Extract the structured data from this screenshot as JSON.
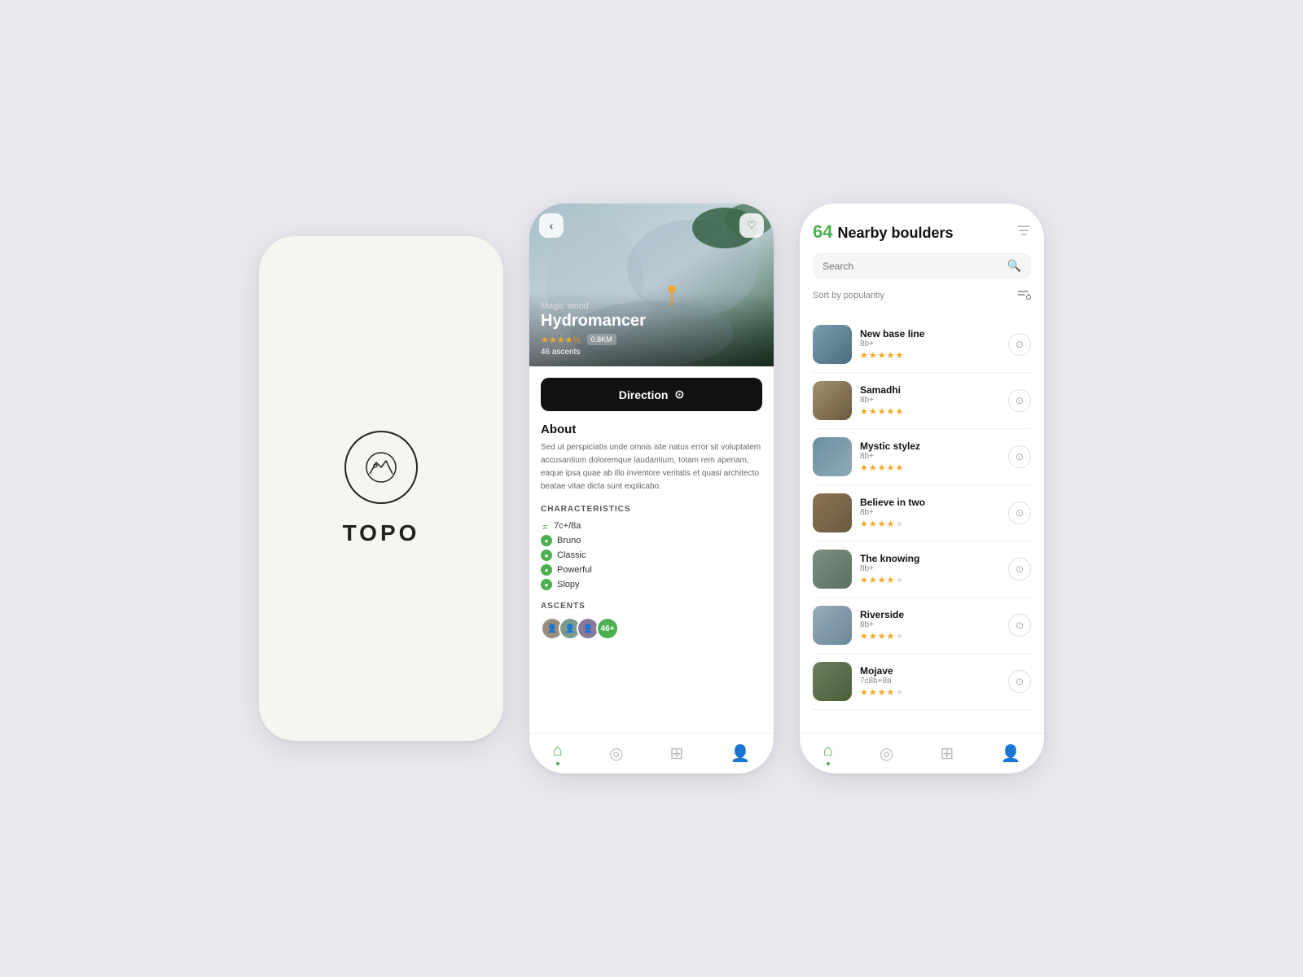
{
  "splash": {
    "app_name": "TOPO"
  },
  "detail": {
    "hero": {
      "subtitle": "Magic wood",
      "title": "Hydromancer",
      "distance": "0.8KM",
      "ascents": "46 ascents",
      "stars": 4.5
    },
    "direction_label": "Direction",
    "about_title": "About",
    "about_body": "Sed ut perspiciatis unde omnis iste natus error sit voluptatem accusantium doloremque laudantium, totam rem aperiam, eaque ipsa quae ab illo inventore veritatis et quasi architecto beatae vitae dicta sunt explicabo.",
    "characteristics_label": "CHARACTERISTICS",
    "characteristics": [
      {
        "icon": "grade",
        "text": "7c+/8a"
      },
      {
        "icon": "person",
        "text": "Bruno"
      },
      {
        "icon": "tag",
        "text": "Classic"
      },
      {
        "icon": "tag",
        "text": "Powerful"
      },
      {
        "icon": "tag",
        "text": "Slopy"
      }
    ],
    "ascents_label": "ASCENTS",
    "ascents_count": "46+"
  },
  "list": {
    "count": "64",
    "title": "Nearby boulders",
    "search_placeholder": "Search",
    "sort_label": "Sort by popularitiy",
    "boulders": [
      {
        "name": "New base line",
        "grade": "8b+",
        "stars": 5,
        "thumb_class": "thumb-1"
      },
      {
        "name": "Samadhi",
        "grade": "8b+",
        "stars": 5,
        "thumb_class": "thumb-2"
      },
      {
        "name": "Mystic stylez",
        "grade": "8b+",
        "stars": 5,
        "thumb_class": "thumb-3"
      },
      {
        "name": "Believe in two",
        "grade": "8b+",
        "stars": 3.5,
        "thumb_class": "thumb-4"
      },
      {
        "name": "The knowing",
        "grade": "8b+",
        "stars": 3.5,
        "thumb_class": "thumb-5"
      },
      {
        "name": "Riverside",
        "grade": "8b+",
        "stars": 3.5,
        "thumb_class": "thumb-6"
      },
      {
        "name": "Mojave",
        "grade": "7c8b+8a",
        "stars": 3.5,
        "thumb_class": "thumb-7"
      }
    ]
  },
  "nav": {
    "home_icon": "⌂",
    "location_icon": "◎",
    "add_icon": "⊞",
    "profile_icon": "👤"
  }
}
